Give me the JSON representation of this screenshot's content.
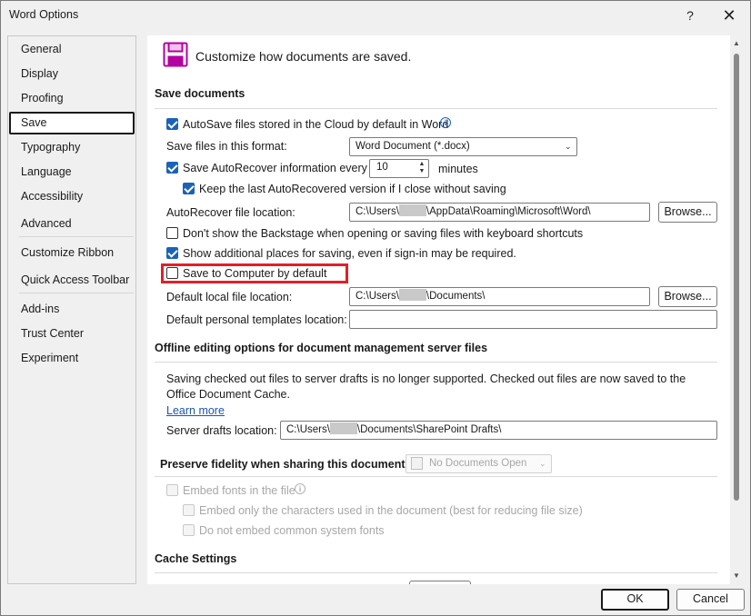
{
  "window": {
    "title": "Word Options",
    "help_glyph": "?",
    "close_glyph": "✕"
  },
  "nav": {
    "items": [
      "General",
      "Display",
      "Proofing",
      "Save",
      "Typography",
      "Language",
      "Accessibility",
      "Advanced",
      "Customize Ribbon",
      "Quick Access Toolbar",
      "Add-ins",
      "Trust Center",
      "Experiment"
    ],
    "selected": "Save"
  },
  "header": {
    "text": "Customize how documents are saved."
  },
  "save_documents": {
    "title": "Save documents",
    "autosave_label": "AutoSave files stored in the Cloud by default in Word",
    "autosave_checked": true,
    "format_label": "Save files in this format:",
    "format_value": "Word Document (*.docx)",
    "autorecover_label": "Save AutoRecover information every",
    "autorecover_checked": true,
    "autorecover_minutes": "10",
    "minutes_label": "minutes",
    "keep_last_label": "Keep the last AutoRecovered version if I close without saving",
    "keep_last_checked": true,
    "autorecover_location_label": "AutoRecover file location:",
    "autorecover_location_prefix": "C:\\Users\\",
    "autorecover_location_suffix": "\\AppData\\Roaming\\Microsoft\\Word\\",
    "browse_label": "Browse...",
    "backstage_label": "Don't show the Backstage when opening or saving files with keyboard shortcuts",
    "backstage_checked": false,
    "additional_places_label": "Show additional places for saving, even if sign-in may be required.",
    "additional_places_checked": true,
    "save_to_computer_label": "Save to Computer by default",
    "save_to_computer_checked": false,
    "default_local_label": "Default local file location:",
    "default_local_prefix": "C:\\Users\\",
    "default_local_suffix": "\\Documents\\",
    "default_templates_label": "Default personal templates location:",
    "default_templates_value": ""
  },
  "offline": {
    "title": "Offline editing options for document management server files",
    "note": "Saving checked out files to server drafts is no longer supported. Checked out files are now saved to the Office Document Cache.",
    "learn_more": "Learn more",
    "server_drafts_label": "Server drafts location:",
    "server_drafts_prefix": "C:\\Users\\",
    "server_drafts_suffix": "\\Documents\\SharePoint Drafts\\"
  },
  "fidelity": {
    "title": "Preserve fidelity when sharing this document:",
    "document_select": "No Documents Open",
    "embed_fonts_label": "Embed fonts in the file",
    "embed_only_label": "Embed only the characters used in the document (best for reducing file size)",
    "no_common_label": "Do not embed common system fonts"
  },
  "cache": {
    "title": "Cache Settings"
  },
  "footer": {
    "ok_label": "OK",
    "cancel_label": "Cancel"
  },
  "colors": {
    "accent": "#1a63b8",
    "highlight": "#e0202a",
    "save_icon": "#b4009e"
  }
}
